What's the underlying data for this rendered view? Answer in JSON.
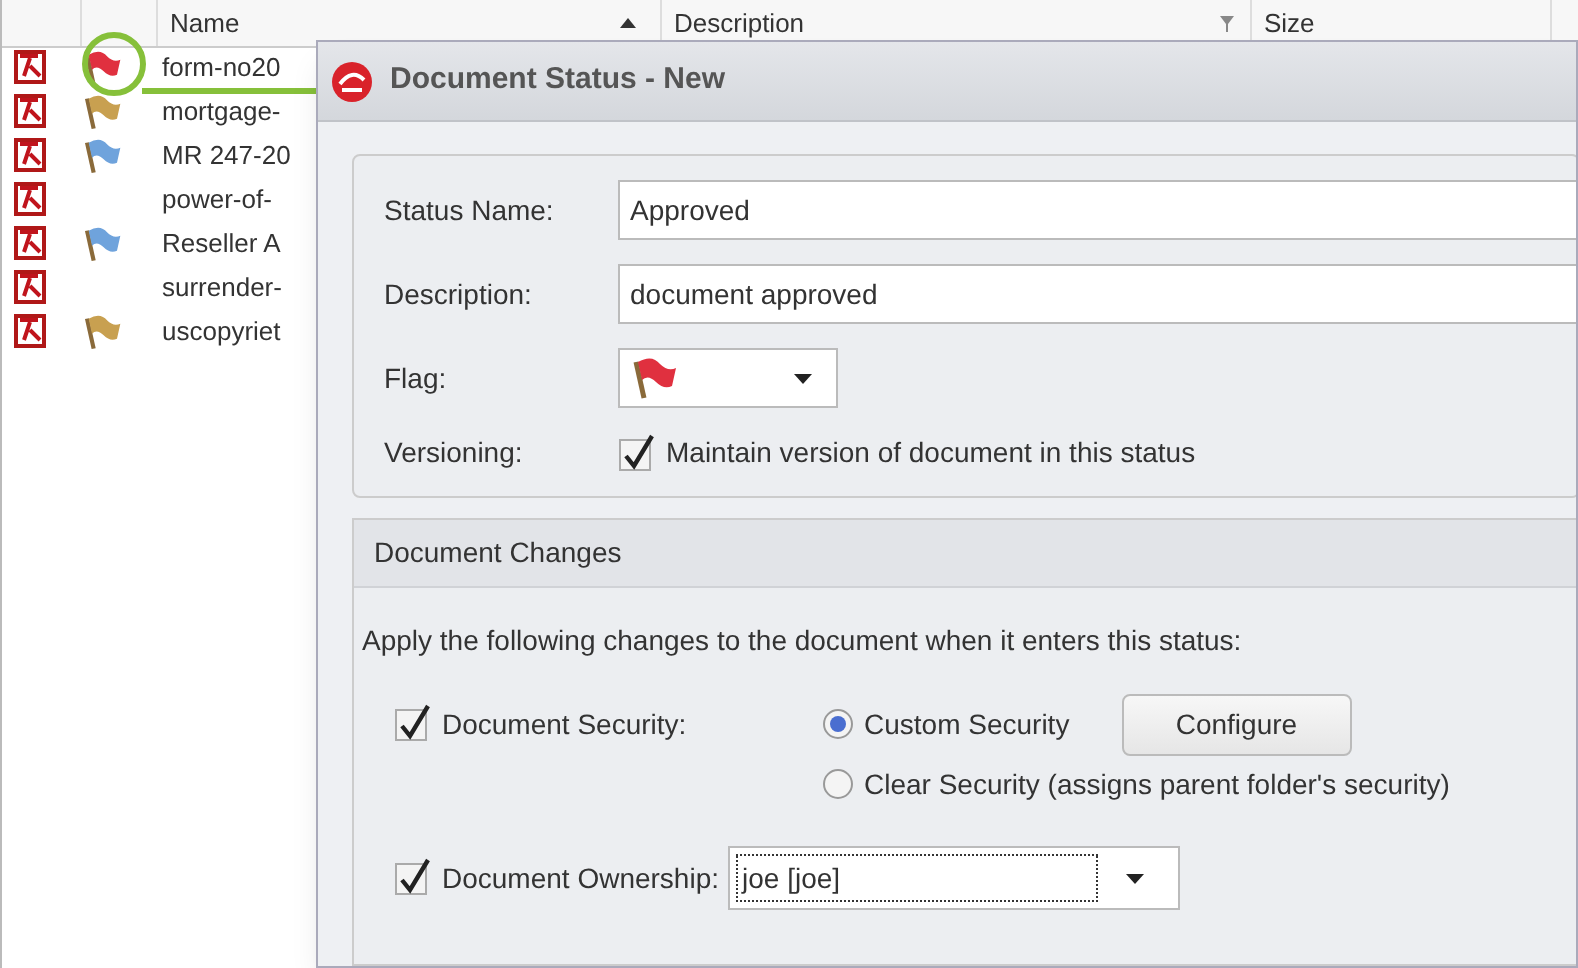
{
  "list": {
    "columns": [
      {
        "label": "Name",
        "sorted": true
      },
      {
        "label": "Description",
        "filter": true
      },
      {
        "label": "Size"
      }
    ],
    "rows": [
      {
        "name": "form-no20",
        "color": "#e0303f",
        "highlighted": true
      },
      {
        "name": "mortgage-",
        "color": "#c8a050",
        "highlighted": false
      },
      {
        "name": "MR 247-20",
        "color": "#6fa3dc",
        "highlighted": false
      },
      {
        "name": "power-of-",
        "highlighted": false
      },
      {
        "name": "Reseller A",
        "color": "#6fa3dc",
        "highlighted": false
      },
      {
        "name": "surrender-",
        "highlighted": false
      },
      {
        "name": "uscopyriet",
        "color": "#c8a050",
        "highlighted": false
      }
    ]
  },
  "dialog": {
    "title": "Document Status - New",
    "status_name": {
      "label": "Status Name:",
      "value": "Approved"
    },
    "description": {
      "label": "Description:",
      "value": "document approved"
    },
    "flag": {
      "label": "Flag:",
      "color": "#e0303f"
    },
    "versioning": {
      "label": "Versioning:",
      "option": "Maintain version of document in this status",
      "checked": true
    },
    "changes": {
      "title": "Document Changes",
      "intro": "Apply the following changes to the document when it enters this status:",
      "security": {
        "label": "Document Security:",
        "checked": true,
        "options": [
          {
            "label": "Custom Security",
            "selected": true
          },
          {
            "label": "Clear Security (assigns parent folder's security)",
            "selected": false
          }
        ],
        "button": "Configure"
      },
      "ownership": {
        "label": "Document Ownership:",
        "checked": true,
        "value": "joe [joe]"
      }
    }
  }
}
